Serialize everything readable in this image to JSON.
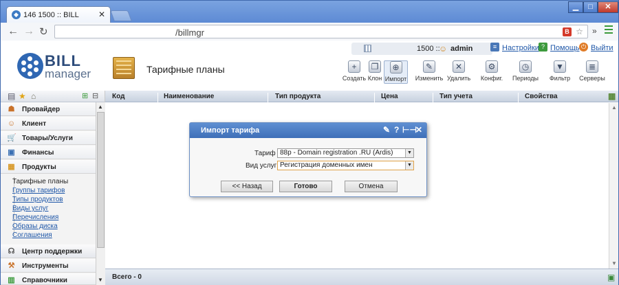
{
  "browser": {
    "tab_title": "146          1500 :: BILL",
    "favicon": "146",
    "url": "/billmgr"
  },
  "userbar": {
    "number": "1500 ::",
    "user": "admin"
  },
  "toplinks": {
    "settings": "Настройки",
    "help": "Помощь",
    "exit": "Выйти"
  },
  "logo": {
    "bill": "BILL",
    "manager": "manager"
  },
  "page_title": "Тарифные планы",
  "toolbar": {
    "create": "Создать",
    "clone": "Клон",
    "import": "Импорт",
    "edit": "Изменить",
    "delete": "Удалить",
    "config": "Конфиг.",
    "periods": "Периоды",
    "filter": "Фильтр",
    "servers": "Серверы"
  },
  "sidebar": {
    "sections": [
      "Провайдер",
      "Клиент",
      "Товары/Услуги",
      "Финансы",
      "Продукты"
    ],
    "sub_items": [
      "Тарифные планы",
      "Группы тарифов",
      "Типы продуктов",
      "Виды услуг",
      "Перечисления",
      "Образы диска",
      "Соглашения"
    ],
    "bottom_sections": [
      "Центр поддержки",
      "Инструменты",
      "Справочники"
    ]
  },
  "table": {
    "columns": [
      "Код",
      "Наименование",
      "Тип продукта",
      "Цена",
      "Тип учета",
      "Свойства"
    ],
    "total": "Всего - 0"
  },
  "dialog": {
    "title": "Импорт тарифа",
    "tariff_label": "Тариф",
    "tariff_value": "88p - Domain registration .RU (Ardis)",
    "service_label": "Вид услуг",
    "service_value": "Регистрация доменных имен",
    "back": "<< Назад",
    "done": "Готово",
    "cancel": "Отмена"
  }
}
